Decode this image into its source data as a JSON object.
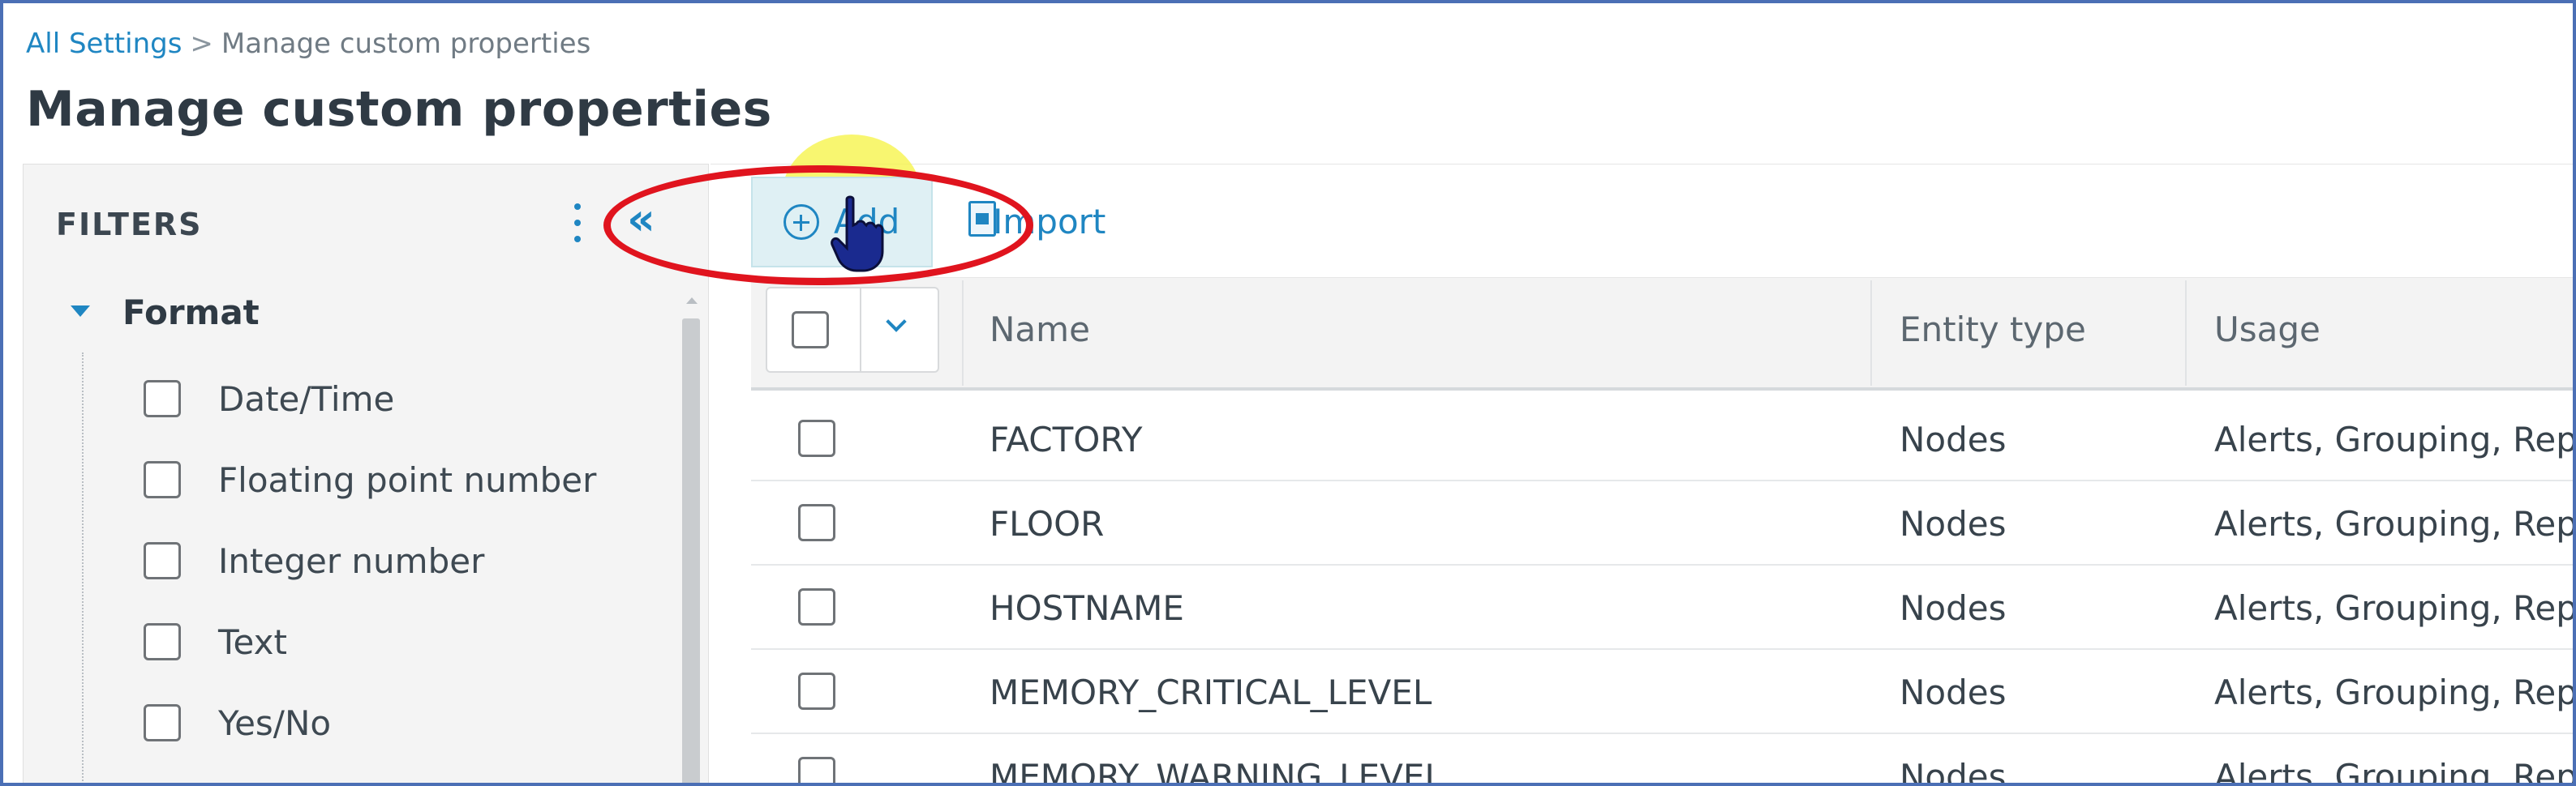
{
  "breadcrumb": {
    "parent": "All Settings",
    "separator": ">",
    "current": "Manage custom properties"
  },
  "page": {
    "title": "Manage custom properties"
  },
  "filters": {
    "title": "FILTERS",
    "collapse_glyph": "«",
    "group": {
      "label": "Format",
      "expanded": true,
      "items": [
        {
          "label": "Date/Time",
          "checked": false
        },
        {
          "label": "Floating point number",
          "checked": false
        },
        {
          "label": "Integer number",
          "checked": false
        },
        {
          "label": "Text",
          "checked": false
        },
        {
          "label": "Yes/No",
          "checked": false
        }
      ]
    }
  },
  "toolbar": {
    "add_label": "Add",
    "import_label": "Import"
  },
  "table": {
    "columns": [
      {
        "label": "Name"
      },
      {
        "label": "Entity type"
      },
      {
        "label": "Usage"
      }
    ],
    "rows": [
      {
        "name": "FACTORY",
        "entity_type": "Nodes",
        "usage": "Alerts, Grouping, Reports"
      },
      {
        "name": "FLOOR",
        "entity_type": "Nodes",
        "usage": "Alerts, Grouping, Reports"
      },
      {
        "name": "HOSTNAME",
        "entity_type": "Nodes",
        "usage": "Alerts, Grouping, Reports"
      },
      {
        "name": "MEMORY_CRITICAL_LEVEL",
        "entity_type": "Nodes",
        "usage": "Alerts, Grouping, Reports"
      },
      {
        "name": "MEMORY_WARNING_LEVEL",
        "entity_type": "Nodes",
        "usage": "Alerts, Grouping, Reports"
      }
    ]
  },
  "colors": {
    "accent": "#1f86c2",
    "annotation_red": "#e0141e",
    "cursor_highlight": "#f6f448"
  }
}
